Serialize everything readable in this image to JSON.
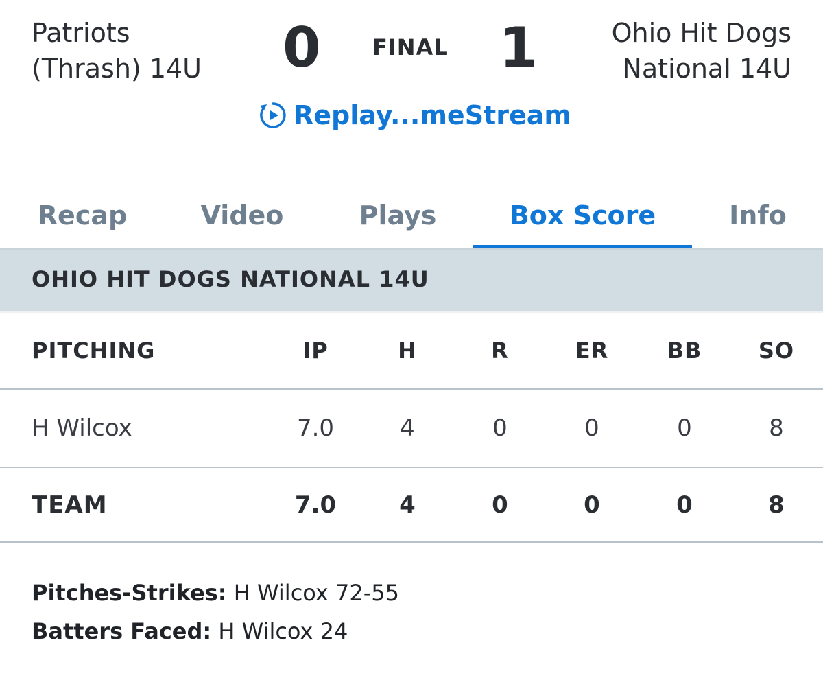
{
  "game": {
    "away_team_line1": "Patriots",
    "away_team_line2": "(Thrash) 14U",
    "away_score": "0",
    "status": "FINAL",
    "home_score": "1",
    "home_team_line1": "Ohio Hit Dogs",
    "home_team_line2": "National 14U",
    "replay_label": "Replay...meStream",
    "replay_icon": "replay-icon"
  },
  "tabs": [
    {
      "label": "Recap"
    },
    {
      "label": "Video"
    },
    {
      "label": "Plays"
    },
    {
      "label": "Box Score",
      "active": true
    },
    {
      "label": "Info"
    }
  ],
  "section": {
    "title": "OHIO HIT DOGS NATIONAL 14U"
  },
  "pitching": {
    "header": [
      "PITCHING",
      "IP",
      "H",
      "R",
      "ER",
      "BB",
      "SO"
    ],
    "rows": [
      [
        "H Wilcox",
        "7.0",
        "4",
        "0",
        "0",
        "0",
        "8"
      ]
    ],
    "team": [
      "TEAM",
      "7.0",
      "4",
      "0",
      "0",
      "0",
      "8"
    ]
  },
  "notes": {
    "pitches_key": "Pitches-Strikes:",
    "pitches_value": " H Wilcox 72-55",
    "batters_key": "Batters Faced:",
    "batters_value": " H Wilcox 24"
  },
  "colors": {
    "accent": "#1177d6",
    "tab_inactive": "#6e7f8f",
    "section_bg": "#d2dce3",
    "text": "#2a2e33"
  }
}
